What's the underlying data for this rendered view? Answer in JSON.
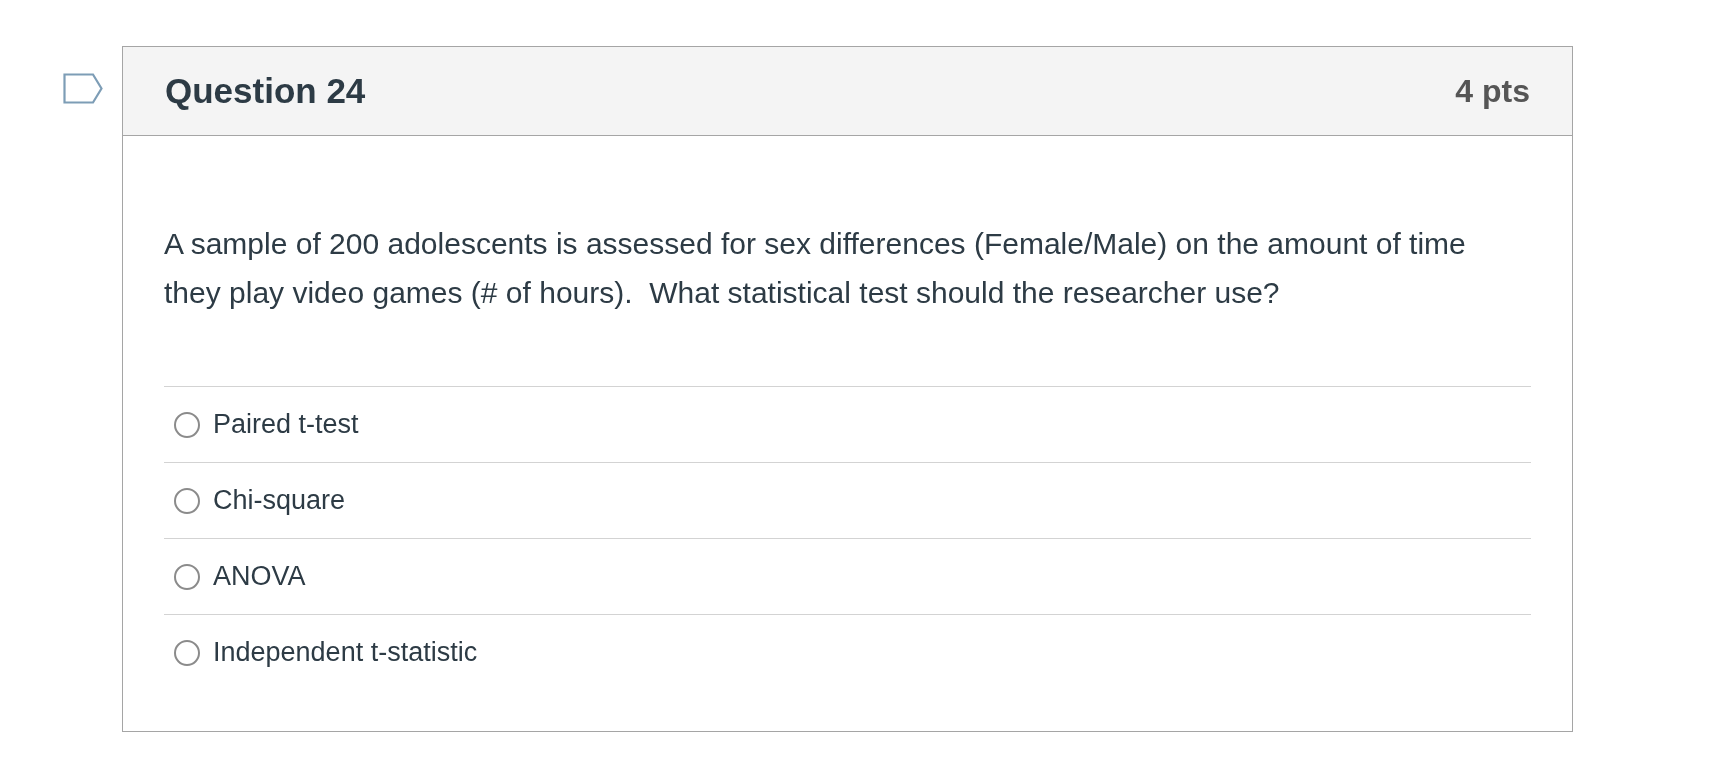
{
  "question": {
    "title": "Question 24",
    "points": "4 pts",
    "flagged": false,
    "text": "A sample of 200 adolescents is assessed for sex differences (Female/Male) on the amount of time they play video games (# of hours).  What statistical test should the researcher use?",
    "answers": [
      {
        "label": "Paired t-test",
        "selected": false
      },
      {
        "label": "Chi-square",
        "selected": false
      },
      {
        "label": "ANOVA",
        "selected": false
      },
      {
        "label": "Independent t-statistic",
        "selected": false
      }
    ]
  }
}
